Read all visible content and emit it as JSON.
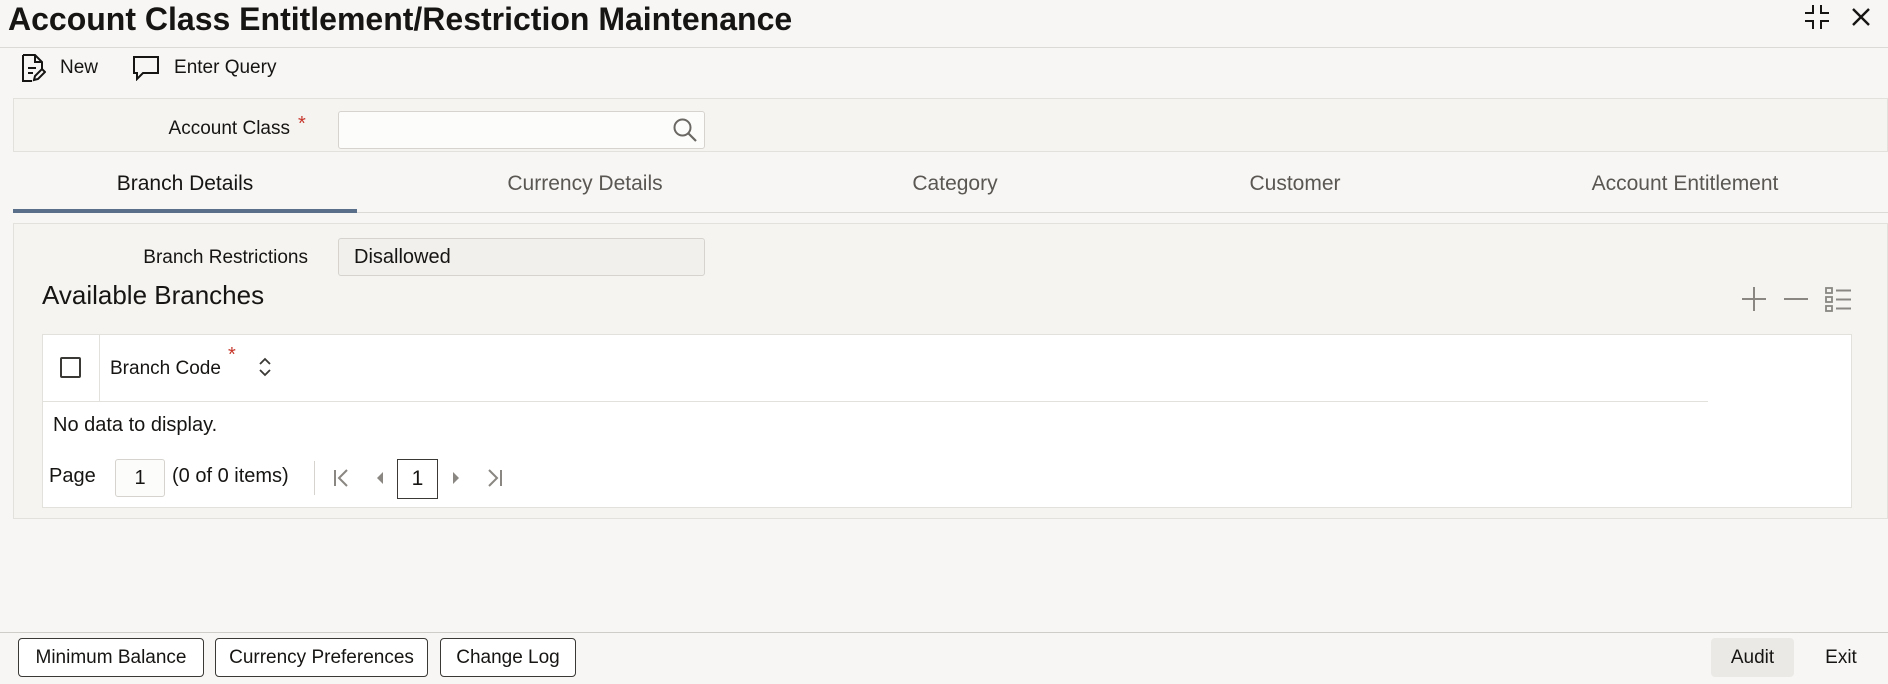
{
  "window": {
    "title": "Account Class Entitlement/Restriction Maintenance"
  },
  "toolbar": {
    "new_label": "New",
    "enter_query_label": "Enter Query"
  },
  "header": {
    "account_class_label": "Account Class",
    "required_mark": "*",
    "account_class_value": ""
  },
  "tabs": [
    {
      "label": "Branch Details",
      "active": true
    },
    {
      "label": "Currency Details",
      "active": false
    },
    {
      "label": "Category",
      "active": false
    },
    {
      "label": "Customer",
      "active": false
    },
    {
      "label": "Account Entitlement",
      "active": false
    }
  ],
  "branch_details": {
    "restrictions_label": "Branch Restrictions",
    "restrictions_value": "Disallowed",
    "section_title": "Available Branches",
    "table": {
      "columns": [
        {
          "label": "Branch Code",
          "required": true
        }
      ],
      "required_mark": "*",
      "empty_message": "No data to display."
    },
    "pagination": {
      "page_label": "Page",
      "page_input": "1",
      "count_text": "(0 of 0 items)",
      "current_page": "1"
    }
  },
  "footer": {
    "buttons": [
      "Minimum Balance",
      "Currency Preferences",
      "Change Log"
    ],
    "audit_label": "Audit",
    "exit_label": "Exit"
  },
  "colors": {
    "accent": "#5a6f8a",
    "required": "#c7362b",
    "text": "#161513",
    "muted_text": "#5a5753"
  }
}
